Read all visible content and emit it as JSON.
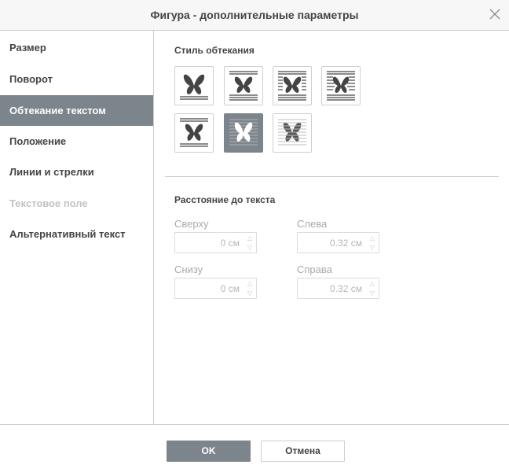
{
  "dialog": {
    "title": "Фигура - дополнительные параметры",
    "close_icon": "close-icon"
  },
  "sidebar": {
    "items": [
      {
        "label": "Размер",
        "state": "normal"
      },
      {
        "label": "Поворот",
        "state": "normal"
      },
      {
        "label": "Обтекание текстом",
        "state": "active"
      },
      {
        "label": "Положение",
        "state": "normal"
      },
      {
        "label": "Линии и стрелки",
        "state": "normal"
      },
      {
        "label": "Текстовое поле",
        "state": "disabled"
      },
      {
        "label": "Альтернативный текст",
        "state": "normal"
      }
    ]
  },
  "wrap_style": {
    "label": "Стиль обтекания",
    "options": [
      "inline",
      "square",
      "tight",
      "through",
      "top-bottom",
      "behind",
      "in-front"
    ],
    "selected": "behind"
  },
  "distance": {
    "label": "Расстояние до текста",
    "top": {
      "label": "Сверху",
      "value": "0 см"
    },
    "left": {
      "label": "Слева",
      "value": "0.32 см"
    },
    "bottom": {
      "label": "Снизу",
      "value": "0 см"
    },
    "right": {
      "label": "Справа",
      "value": "0.32 см"
    }
  },
  "footer": {
    "ok_label": "OK",
    "cancel_label": "Отмена"
  },
  "colors": {
    "accent": "#7d858c",
    "border": "#cbcbcb",
    "text": "#444444",
    "disabled": "#c3c3c3"
  }
}
